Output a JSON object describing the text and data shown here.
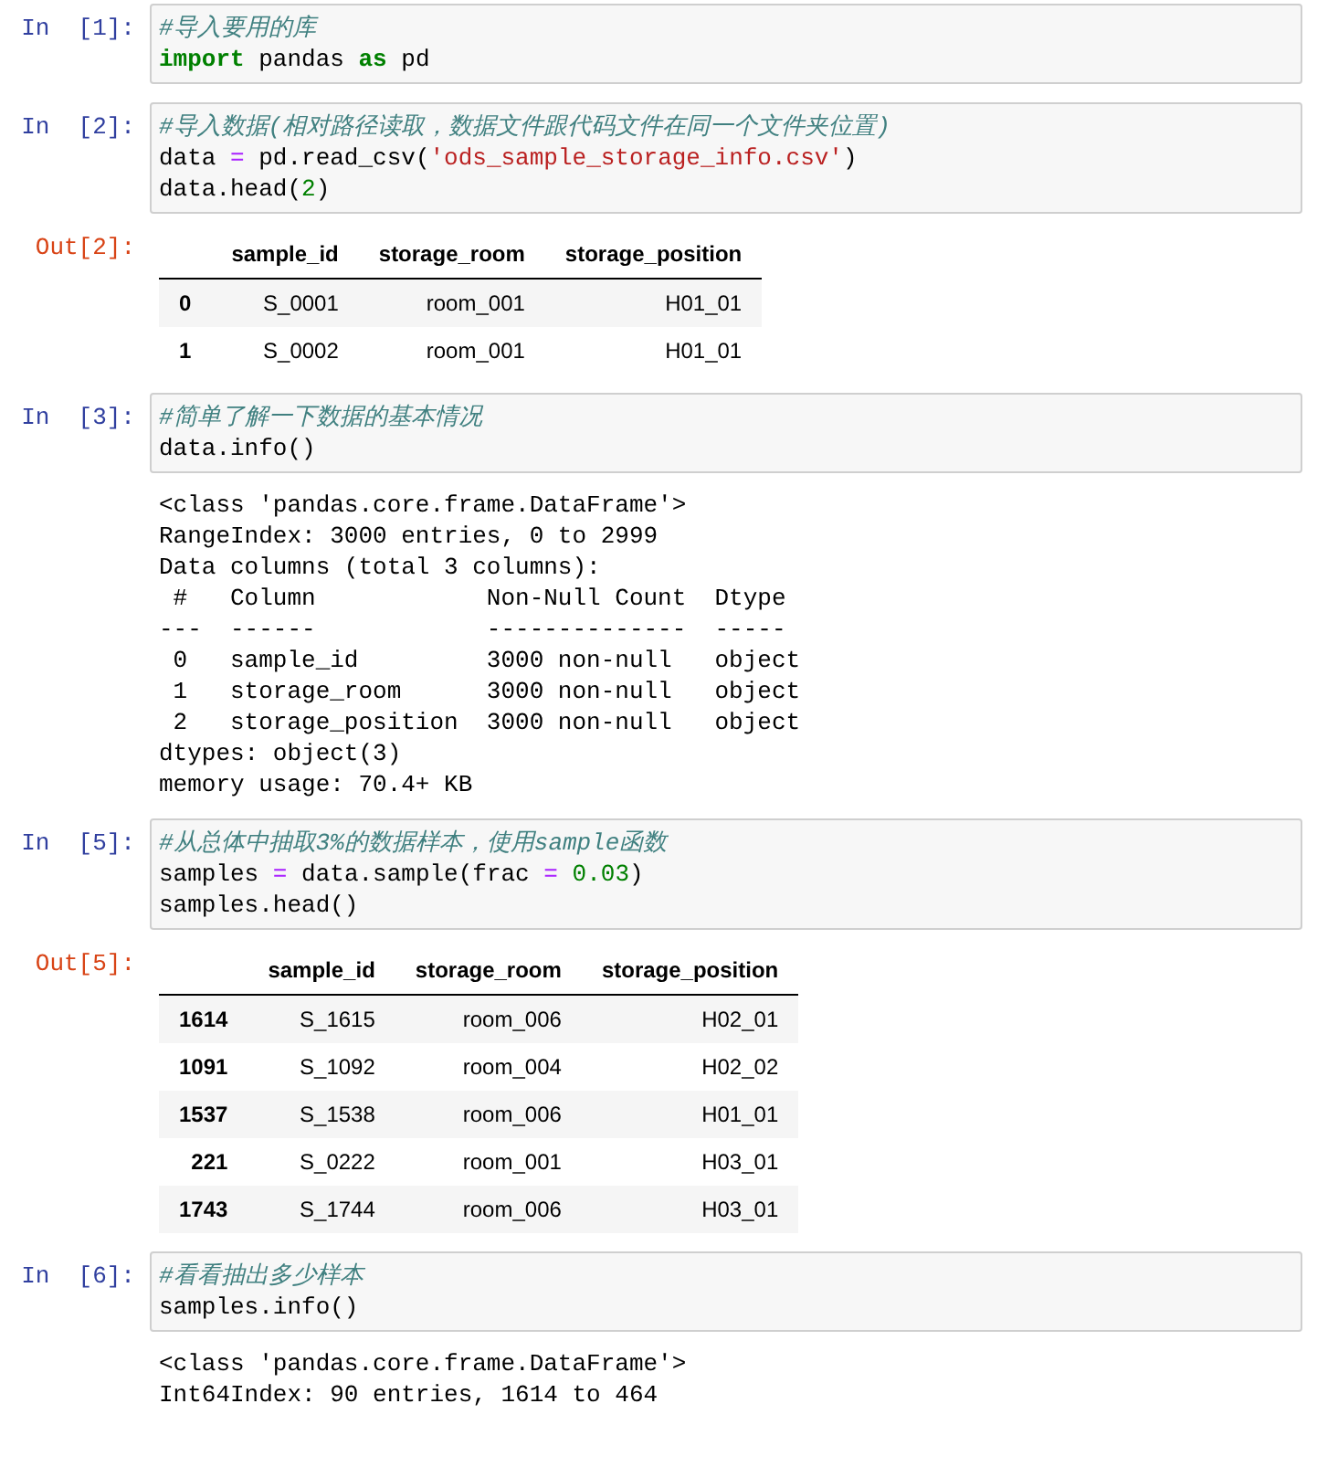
{
  "cells": [
    {
      "prompt": "In  [1]:",
      "code": [
        [
          {
            "kind": "comment",
            "s": "#导入要用的库"
          }
        ],
        [
          {
            "kind": "keyword",
            "s": "import"
          },
          {
            "kind": "plain",
            "s": " pandas "
          },
          {
            "kind": "keyword",
            "s": "as"
          },
          {
            "kind": "plain",
            "s": " pd"
          }
        ]
      ]
    },
    {
      "prompt": "In  [2]:",
      "code": [
        [
          {
            "kind": "comment",
            "s": "#导入数据(相对路径读取，数据文件跟代码文件在同一个文件夹位置)"
          }
        ],
        [
          {
            "kind": "plain",
            "s": "data "
          },
          {
            "kind": "operator",
            "s": "="
          },
          {
            "kind": "plain",
            "s": " pd.read_csv("
          },
          {
            "kind": "string",
            "s": "'ods_sample_storage_info.csv'"
          },
          {
            "kind": "plain",
            "s": ")"
          }
        ],
        [
          {
            "kind": "plain",
            "s": "data.head("
          },
          {
            "kind": "number",
            "s": "2"
          },
          {
            "kind": "plain",
            "s": ")"
          }
        ]
      ],
      "output": {
        "kind": "table",
        "prompt": "Out[2]:",
        "columns": [
          "sample_id",
          "storage_room",
          "storage_position"
        ],
        "rows": [
          {
            "index": "0",
            "values": [
              "S_0001",
              "room_001",
              "H01_01"
            ]
          },
          {
            "index": "1",
            "values": [
              "S_0002",
              "room_001",
              "H01_01"
            ]
          }
        ]
      }
    },
    {
      "prompt": "In  [3]:",
      "code": [
        [
          {
            "kind": "comment",
            "s": "#简单了解一下数据的基本情况"
          }
        ],
        [
          {
            "kind": "plain",
            "s": "data.info()"
          }
        ]
      ],
      "output": {
        "kind": "text",
        "lines": [
          "<class 'pandas.core.frame.DataFrame'>",
          "RangeIndex: 3000 entries, 0 to 2999",
          "Data columns (total 3 columns):",
          " #   Column            Non-Null Count  Dtype ",
          "---  ------            --------------  ----- ",
          " 0   sample_id         3000 non-null   object",
          " 1   storage_room      3000 non-null   object",
          " 2   storage_position  3000 non-null   object",
          "dtypes: object(3)",
          "memory usage: 70.4+ KB"
        ]
      }
    },
    {
      "prompt": "In  [5]:",
      "code": [
        [
          {
            "kind": "comment",
            "s": "#从总体中抽取3%的数据样本，使用sample函数"
          }
        ],
        [
          {
            "kind": "plain",
            "s": "samples "
          },
          {
            "kind": "operator",
            "s": "="
          },
          {
            "kind": "plain",
            "s": " data.sample(frac "
          },
          {
            "kind": "operator",
            "s": "="
          },
          {
            "kind": "number",
            "s": " 0.03"
          },
          {
            "kind": "plain",
            "s": ")"
          }
        ],
        [
          {
            "kind": "plain",
            "s": "samples.head()"
          }
        ]
      ],
      "output": {
        "kind": "table",
        "prompt": "Out[5]:",
        "columns": [
          "sample_id",
          "storage_room",
          "storage_position"
        ],
        "rows": [
          {
            "index": "1614",
            "values": [
              "S_1615",
              "room_006",
              "H02_01"
            ]
          },
          {
            "index": "1091",
            "values": [
              "S_1092",
              "room_004",
              "H02_02"
            ]
          },
          {
            "index": "1537",
            "values": [
              "S_1538",
              "room_006",
              "H01_01"
            ]
          },
          {
            "index": "221",
            "values": [
              "S_0222",
              "room_001",
              "H03_01"
            ]
          },
          {
            "index": "1743",
            "values": [
              "S_1744",
              "room_006",
              "H03_01"
            ]
          }
        ]
      }
    },
    {
      "prompt": "In  [6]:",
      "code": [
        [
          {
            "kind": "comment",
            "s": "#看看抽出多少样本"
          }
        ],
        [
          {
            "kind": "plain",
            "s": "samples.info()"
          }
        ]
      ],
      "output": {
        "kind": "text",
        "lines": [
          "<class 'pandas.core.frame.DataFrame'>",
          "Int64Index: 90 entries, 1614 to 464"
        ]
      }
    }
  ]
}
